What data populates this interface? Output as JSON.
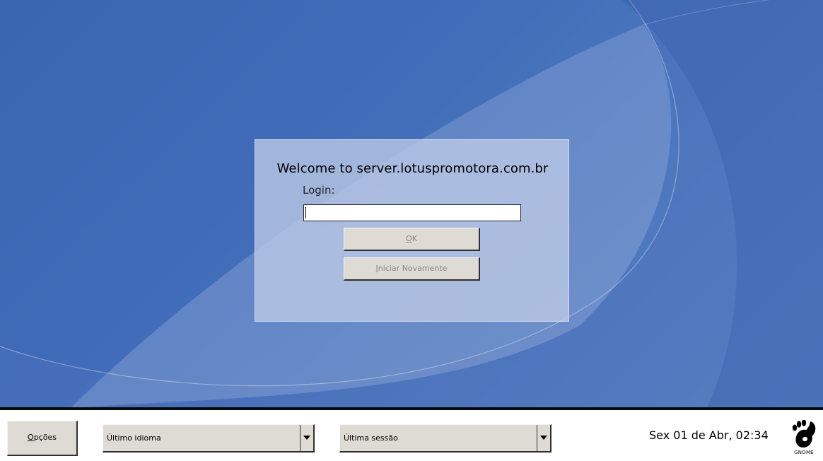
{
  "login": {
    "welcome": "Welcome to server.lotuspromotora.com.br",
    "label": "Login:",
    "input_value": "",
    "ok_button": {
      "mnemonic": "O",
      "rest": "K"
    },
    "restart_button": {
      "mnemonic": "I",
      "rest": "niciar Novamente"
    }
  },
  "bottom_panel": {
    "options_button": {
      "mnemonic": "O",
      "rest": "pções"
    },
    "language_select": "Último idioma",
    "session_select": "Última sessão",
    "clock": "Sex 01 de Abr, 02:34",
    "logo_text": "GNOME"
  },
  "colors": {
    "desktop_blue": "#3f6bb8",
    "panel_background": "#ffffff",
    "button_face": "#dedad4"
  },
  "icons": [
    "dropdown-arrow-icon",
    "gnome-foot-icon"
  ]
}
